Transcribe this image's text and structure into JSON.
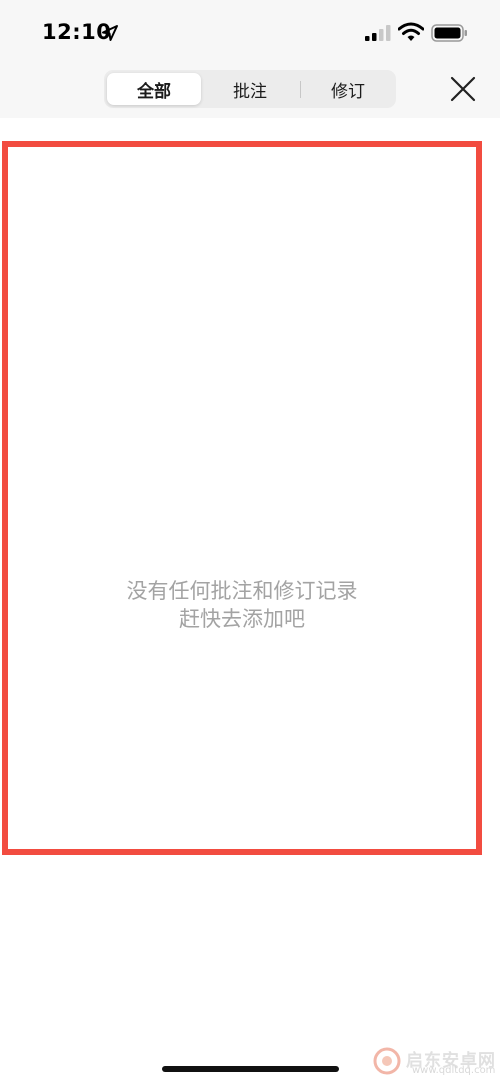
{
  "status_bar": {
    "time": "12:10",
    "icons": [
      "location-arrow-icon",
      "signal-icon",
      "wifi-icon",
      "battery-icon"
    ]
  },
  "header": {
    "tabs": [
      {
        "label": "全部",
        "active": true
      },
      {
        "label": "批注",
        "active": false
      },
      {
        "label": "修订",
        "active": false
      }
    ],
    "close_icon": "close-icon"
  },
  "content": {
    "empty_line1": "没有任何批注和修订记录",
    "empty_line2": "赶快去添加吧",
    "highlight_color": "#f24c40"
  },
  "watermark": {
    "name": "启东安卓网",
    "url": "www.qdltdq.com"
  }
}
